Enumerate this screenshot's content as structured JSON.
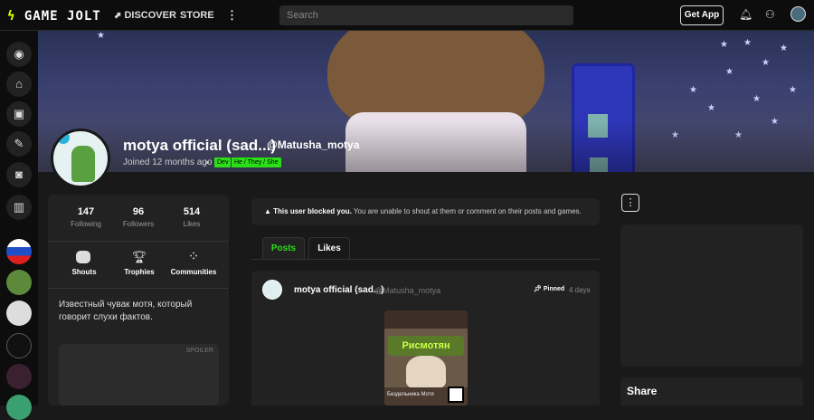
{
  "topbar": {
    "logo": "GAME JOLT",
    "discover": "DISCOVER",
    "store": "STORE",
    "more_icon": "⋮",
    "search_placeholder": "Search",
    "get_app": "Get App"
  },
  "profile": {
    "display_name": "motya official (sad...)",
    "username": "@Matusha_motya",
    "joined": "Joined 12 months ago",
    "tags": [
      "Dev",
      "He / They / She"
    ],
    "stats": [
      {
        "value": "147",
        "label": "Following"
      },
      {
        "value": "96",
        "label": "Followers"
      },
      {
        "value": "514",
        "label": "Likes"
      }
    ],
    "actions": [
      {
        "label": "Shouts",
        "icon": "speech-bubble-icon"
      },
      {
        "label": "Trophies",
        "icon": "trophy-icon"
      },
      {
        "label": "Communities",
        "icon": "grid-dots-icon"
      }
    ],
    "bio": "Известный чувак мотя, который говорит слухи фактов.",
    "spoiler_label": "SPOILER"
  },
  "notice": {
    "bold": "This user blocked you.",
    "text": " You are unable to shout at them or comment on their posts and games."
  },
  "tabs": [
    {
      "label": "Posts",
      "active": true
    },
    {
      "label": "Likes",
      "active": false
    }
  ],
  "post": {
    "author": "motya official (sad...)",
    "username": "@Matusha_motya",
    "pinned": "Pinned",
    "age": "4 days",
    "image_title": "Рисмотян",
    "image_footer": "Бездельника Мотя"
  },
  "right": {
    "share": "Share"
  },
  "colors": {
    "accent_green": "#2bde18",
    "logo_bolt": "#ccff00",
    "dev_badge": "#2ab3d9"
  }
}
